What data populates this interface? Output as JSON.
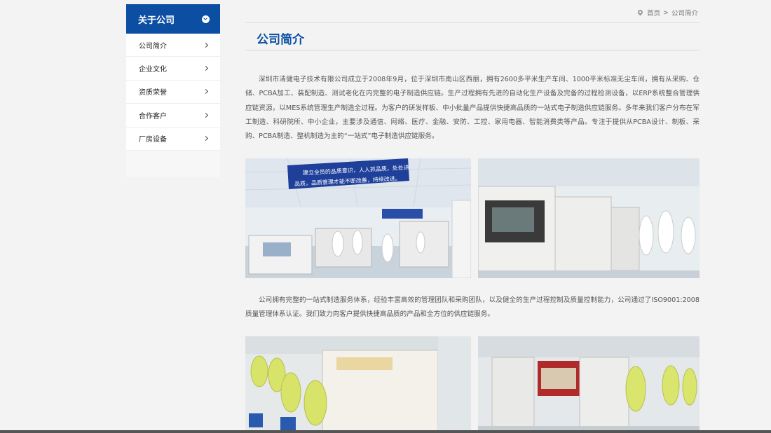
{
  "sidebar": {
    "title": "关于公司",
    "items": [
      {
        "label": "公司简介"
      },
      {
        "label": "企业文化"
      },
      {
        "label": "资质荣誉"
      },
      {
        "label": "合作客户"
      },
      {
        "label": "厂房设备"
      }
    ]
  },
  "breadcrumb": {
    "home": "首页",
    "separator": ">",
    "current": "公司简介"
  },
  "page": {
    "title": "公司简介",
    "paragraph1": "深圳市清健电子技术有限公司成立于2008年9月，位于深圳市南山区西丽，拥有2600多平米生产车间、1000平米标准无尘车间，拥有从采购、仓储、PCBA加工、装配制造、测试老化在内完整的电子制造供应链。生产过程拥有先进的自动化生产设备及完备的过程检测设备，以ERP系统整合管理供应链资源，以MES系统管理生产制造全过程。为客户的研发样板、中小批量产品提供快捷高品质的一站式电子制造供应链服务。多年来我们客户分布在军工制造、科研院所、中小企业，主要涉及通信、网络、医疗、金融、安防、工控、家用电器、智能消费类等产品。专注于提供从PCBA设计、制板、采购、PCBA制造、整机制造为主的“一站式”电子制造供应链服务。",
    "paragraph2": "公司拥有完整的一站式制造服务体系，经验丰富高效的管理团队和采购团队，以及健全的生产过程控制及质量控制能力，公司通过了ISO9001:2008质量管理体系认证。我们致力向客户提供快捷高品质的产品和全方位的供应链服务。"
  },
  "photos": {
    "banner_line1": "建立全员的品质意识，人人抓品质，处处讲",
    "banner_line2": "品质，品质管理才能不断改善，持续改进。"
  },
  "colors": {
    "accent": "#0b4ea2",
    "background": "#f3f3f3",
    "text": "#555555"
  }
}
